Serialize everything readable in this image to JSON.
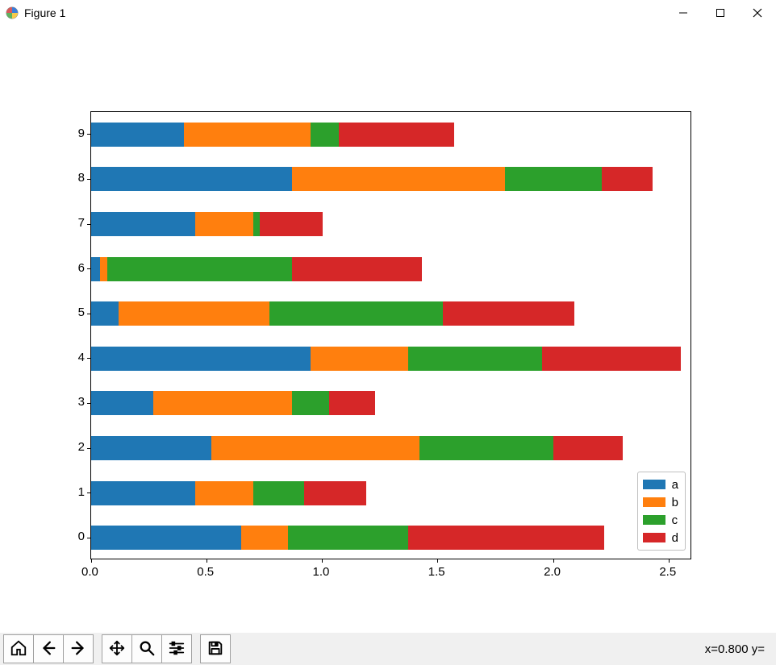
{
  "window": {
    "title": "Figure 1"
  },
  "status": {
    "text": "x=0.800 y="
  },
  "toolbar": {
    "home": "Home",
    "back": "Back",
    "forward": "Forward",
    "pan": "Pan",
    "zoom": "Zoom",
    "configure": "Configure subplots",
    "save": "Save"
  },
  "colors": {
    "a": "#1f77b4",
    "b": "#ff7f0e",
    "c": "#2ca02c",
    "d": "#d62728"
  },
  "legend": [
    {
      "key": "a",
      "label": "a"
    },
    {
      "key": "b",
      "label": "b"
    },
    {
      "key": "c",
      "label": "c"
    },
    {
      "key": "d",
      "label": "d"
    }
  ],
  "chart_data": {
    "type": "bar",
    "orientation": "horizontal",
    "stacked": true,
    "xlabel": "",
    "ylabel": "",
    "xlim": [
      0.0,
      2.6
    ],
    "xticks": [
      0.0,
      0.5,
      1.0,
      1.5,
      2.0,
      2.5
    ],
    "categories": [
      0,
      1,
      2,
      3,
      4,
      5,
      6,
      7,
      8,
      9
    ],
    "series": [
      {
        "name": "a",
        "values": [
          0.65,
          0.45,
          0.52,
          0.27,
          0.95,
          0.12,
          0.04,
          0.45,
          0.87,
          0.4
        ]
      },
      {
        "name": "b",
        "values": [
          0.2,
          0.25,
          0.9,
          0.6,
          0.42,
          0.65,
          0.03,
          0.25,
          0.92,
          0.55
        ]
      },
      {
        "name": "c",
        "values": [
          0.52,
          0.22,
          0.58,
          0.16,
          0.58,
          0.75,
          0.8,
          0.03,
          0.42,
          0.12
        ]
      },
      {
        "name": "d",
        "values": [
          0.85,
          0.27,
          0.3,
          0.2,
          0.6,
          0.57,
          0.56,
          0.27,
          0.22,
          0.5
        ]
      }
    ]
  }
}
